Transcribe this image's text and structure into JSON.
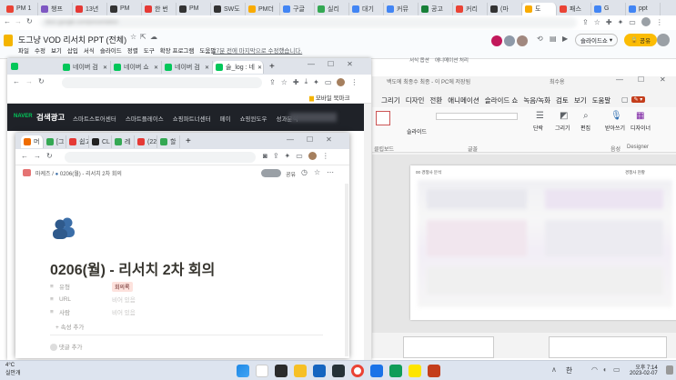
{
  "top_browser": {
    "tabs": [
      {
        "label": "PM 1",
        "color": "#ea4335"
      },
      {
        "label": "챙프",
        "color": "#7e57c2"
      },
      {
        "label": "13년",
        "color": "#e53935"
      },
      {
        "label": "PM",
        "color": "#333333"
      },
      {
        "label": "한 번",
        "color": "#e53935"
      },
      {
        "label": "PM",
        "color": "#333333"
      },
      {
        "label": "SW도",
        "color": "#333333"
      },
      {
        "label": "PM더",
        "color": "#f9ab00"
      },
      {
        "label": "구글",
        "color": "#4285f4"
      },
      {
        "label": "실리",
        "color": "#34a853"
      },
      {
        "label": "대기",
        "color": "#4285f4"
      },
      {
        "label": "커뮤",
        "color": "#4285f4"
      },
      {
        "label": "공고",
        "color": "#188038"
      },
      {
        "label": "커리",
        "color": "#ea4335"
      },
      {
        "label": "(마",
        "color": "#333333"
      },
      {
        "label": "도",
        "color": "#f9ab00"
      },
      {
        "label": "패스",
        "color": "#ea4335"
      },
      {
        "label": "G",
        "color": "#4285f4"
      },
      {
        "label": "ppt",
        "color": "#4285f4"
      }
    ],
    "url": "docs.google.com/presentation"
  },
  "slides_header": {
    "title": "도그냥 VOD 리서치 PPT (전체)",
    "menus": [
      "파일",
      "수정",
      "보기",
      "삽입",
      "서식",
      "슬라이드",
      "정렬",
      "도구",
      "확장 프로그램",
      "도움말"
    ],
    "last_edit": "17분 전에 마지막으로 수정했습니다.",
    "slideshow_label": "슬라이드쇼",
    "share_label": "공유",
    "sub_items": [
      "서식 옵션",
      "애니메이션 처리"
    ]
  },
  "naver_window": {
    "tabs": [
      "네이버 검",
      "네이버 쇼",
      "네이버 검",
      "술_log : 네"
    ],
    "bookmark": "모바일 북마크",
    "brand": "NAVER",
    "brand_suffix": "검색광고",
    "nav": [
      "스마트스토어센터",
      "스마트플레이스",
      "쇼핑파트너센터",
      "페이",
      "쇼핑윈도우",
      "성과분석"
    ]
  },
  "notion_window": {
    "tabs": [
      "머",
      "[그",
      "쉽고",
      "CL",
      "레",
      "(22",
      "할"
    ],
    "breadcrumb_root": "마케즈",
    "breadcrumb_page": "0206(월) - 리서치 2차 회의",
    "share_label": "공유",
    "page_title": "0206(월) - 리서치 2차 회의",
    "properties": [
      {
        "label": "유형",
        "value": "회의록",
        "tag": true
      },
      {
        "label": "URL",
        "value": "비어 있음",
        "tag": false
      },
      {
        "label": "사람",
        "value": "비어 있음",
        "tag": false
      }
    ],
    "add_property": "속성 추가",
    "comment": "댓글 추가"
  },
  "ppt_window": {
    "title": "백도에 최종수 최종 - 이 PC에 저장됨",
    "user": "최수용",
    "menus": [
      "그리기",
      "디자인",
      "전환",
      "애니메이션",
      "슬라이드 쇼",
      "녹음/녹화",
      "검토",
      "보기",
      "도움말"
    ],
    "ribbon": [
      "슬라이드",
      "단락",
      "그리기",
      "편집",
      "받아쓰기",
      "디자이너"
    ],
    "groups": [
      "공유",
      "음성",
      "Designer",
      "글꼴",
      "클립보드"
    ],
    "slide_title": "00 경쟁사 분석",
    "slide_caption": "경쟁사 현황"
  },
  "taskbar": {
    "weather_temp": "4°C",
    "weather_label": "실안개",
    "ime": "한",
    "time": "오후 7:14",
    "date": "2023-02-07"
  }
}
